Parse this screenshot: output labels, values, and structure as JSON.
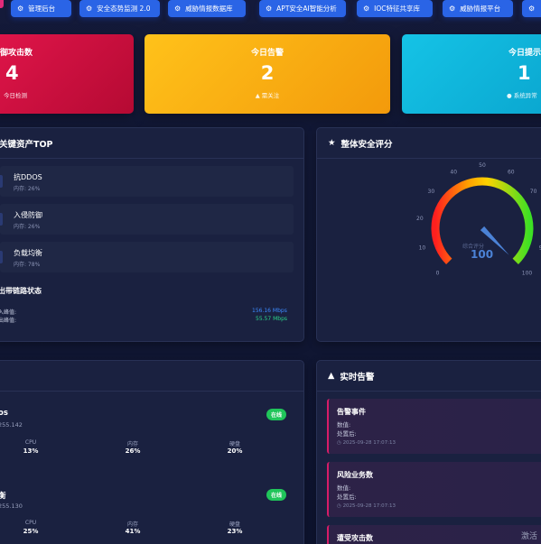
{
  "nav": {
    "items": [
      {
        "label": "管理后台",
        "icon": "gear-icon"
      },
      {
        "label": "安全态势监测 2.0",
        "icon": "gear-icon"
      },
      {
        "label": "威胁情报数据库",
        "icon": "gear-icon"
      },
      {
        "label": "APT安全AI智能分析",
        "icon": "gear-icon"
      },
      {
        "label": "IOC特征共享库",
        "icon": "gear-icon"
      },
      {
        "label": "威胁情报平台",
        "icon": "gear-icon"
      }
    ]
  },
  "stats": {
    "attack": {
      "title": "御攻击数",
      "value": "4",
      "sub": "今日检测",
      "color": "#e0154a"
    },
    "alarm": {
      "title": "今日告警",
      "value": "2",
      "sub": "需关注",
      "color": "#f9ae10"
    },
    "tip": {
      "title": "今日提示",
      "value": "1",
      "sub": "系统异常",
      "color": "#12b8dd"
    }
  },
  "assets": {
    "title": "关键资产TOP",
    "items": [
      {
        "name": "抗DDOS",
        "sub": "内存: 26%"
      },
      {
        "name": "入侵防御",
        "sub": "内存: 26%"
      },
      {
        "name": "负载均衡",
        "sub": "内存: 78%"
      }
    ],
    "link": {
      "title": "出带链路状态",
      "rows": [
        {
          "label": "入峰值:",
          "value": "156.16 Mbps",
          "color": "#3d8bff"
        },
        {
          "label": "出峰值:",
          "value": "55.57 Mbps",
          "color": "#2bd48a"
        }
      ]
    }
  },
  "gauge": {
    "title": "整体安全评分",
    "value": 100,
    "value_label": "100",
    "caption": "综合评分",
    "ticks": [
      "0",
      "10",
      "20",
      "30",
      "40",
      "50",
      "60",
      "70",
      "80",
      "90",
      "100"
    ]
  },
  "servers": {
    "items": [
      {
        "name": "os",
        "ip": "255.142",
        "status": "在线",
        "cpu_label": "CPU",
        "cpu": "13%",
        "mem_label": "内存",
        "mem": "26%",
        "disk_label": "硬盘",
        "disk": "20%"
      },
      {
        "name": "衡",
        "ip": "255.130",
        "status": "在线",
        "cpu_label": "CPU",
        "cpu": "25%",
        "mem_label": "内存",
        "mem": "41%",
        "disk_label": "硬盘",
        "disk": "23%"
      }
    ]
  },
  "alerts": {
    "title": "实时告警",
    "items": [
      {
        "title": "告警事件",
        "line1": "数值:",
        "line2": "处置后:",
        "time": "2025-09-28 17:07:13"
      },
      {
        "title": "风险业务数",
        "line1": "数值:",
        "line2": "处置后:",
        "time": "2025-09-28 17:07:13"
      },
      {
        "title": "遭受攻击数"
      }
    ]
  },
  "watermark": "激活"
}
